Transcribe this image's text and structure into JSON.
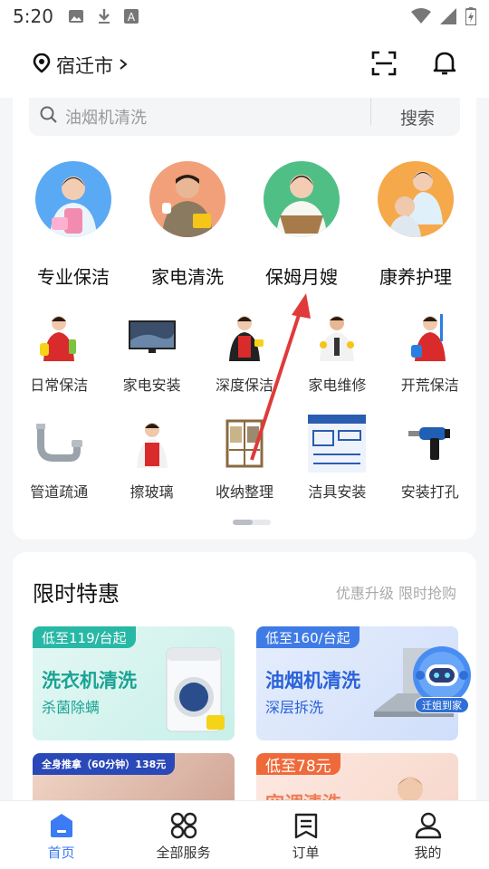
{
  "status": {
    "time": "5:20"
  },
  "header": {
    "city": "宿迁市"
  },
  "search": {
    "placeholder": "油烟机清洗",
    "button": "搜索"
  },
  "big_categories": [
    {
      "label": "专业保洁",
      "icon": "cleaner-avatar",
      "bg": "#5aa9f5"
    },
    {
      "label": "家电清洗",
      "icon": "appliance-cleaner-avatar",
      "bg": "#f2a07a"
    },
    {
      "label": "保姆月嫂",
      "icon": "nanny-avatar",
      "bg": "#4fbf86"
    },
    {
      "label": "康养护理",
      "icon": "caregiver-avatar",
      "bg": "#f5a94a"
    }
  ],
  "small_categories": [
    {
      "label": "日常保洁",
      "icon": "daily-cleaning-icon"
    },
    {
      "label": "家电安装",
      "icon": "tv-install-icon"
    },
    {
      "label": "深度保洁",
      "icon": "deep-cleaning-icon"
    },
    {
      "label": "家电维修",
      "icon": "appliance-repair-icon"
    },
    {
      "label": "开荒保洁",
      "icon": "new-home-cleaning-icon"
    },
    {
      "label": "管道疏通",
      "icon": "pipe-icon"
    },
    {
      "label": "擦玻璃",
      "icon": "window-cleaning-icon"
    },
    {
      "label": "收纳整理",
      "icon": "wardrobe-icon"
    },
    {
      "label": "洁具安装",
      "icon": "sanitary-install-icon"
    },
    {
      "label": "安装打孔",
      "icon": "drill-icon"
    }
  ],
  "promo": {
    "title": "限时特惠",
    "subtitle": "优惠升级 限时抢购",
    "tiles": [
      {
        "tag": "低至119/台起",
        "title": "洗衣机清洗",
        "sub": "杀菌除螨"
      },
      {
        "tag": "低至160/台起",
        "title": "油烟机清洗",
        "sub": "深层拆洗"
      },
      {
        "tag": "全身推拿（60分钟）138元"
      },
      {
        "tag": "低至78元",
        "title": "空调清洗"
      }
    ]
  },
  "float_badge": "迁姐到家",
  "nav": [
    {
      "label": "首页",
      "icon": "home-icon"
    },
    {
      "label": "全部服务",
      "icon": "grid-icon"
    },
    {
      "label": "订单",
      "icon": "order-icon"
    },
    {
      "label": "我的",
      "icon": "user-icon"
    }
  ],
  "colors": {
    "accent": "#3c7bf4",
    "arrow": "#e03a3a"
  }
}
